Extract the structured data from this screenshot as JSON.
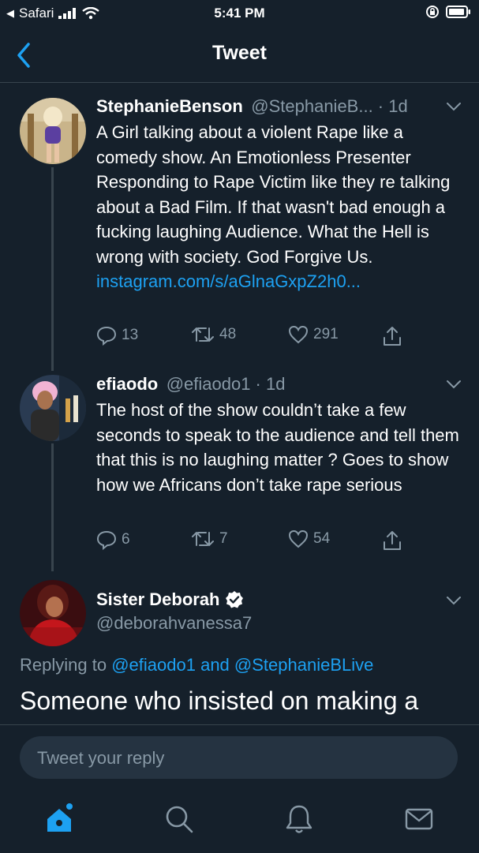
{
  "status_bar": {
    "back_app": "Safari",
    "time": "5:41 PM"
  },
  "header": {
    "title": "Tweet"
  },
  "tweets": [
    {
      "display_name": "StephanieBenson",
      "handle_time": "@StephanieB... · 1d",
      "text": "A Girl talking about a violent Rape like a comedy show. An Emotionless Presenter Responding to Rape Victim like they re talking about a Bad Film. If that wasn't bad enough a fucking laughing Audience. What the Hell is wrong with society. God Forgive Us.",
      "link": "instagram.com/s/aGlnaGxpZ2h0...",
      "replies": "13",
      "retweets": "48",
      "likes": "291"
    },
    {
      "display_name": "efiaodo",
      "handle_time": "@efiaodo1 · 1d",
      "text": "The host of the show couldn’t take a few seconds to speak to the audience and tell them that this is no laughing matter ? Goes to show how we Africans don’t take rape serious",
      "replies": "6",
      "retweets": "7",
      "likes": "54"
    },
    {
      "display_name": "Sister Deborah",
      "handle": "@deborahvanessa7"
    }
  ],
  "replying": {
    "prefix": "Replying to",
    "mention1": "@efiaodo1",
    "and": "and",
    "mention2": "@StephanieBLive"
  },
  "main_text": "Someone who insisted on making a",
  "composer": {
    "placeholder": "Tweet your reply"
  },
  "colors": {
    "background": "#15202b",
    "accent": "#1da1f2",
    "muted": "#8899a6"
  }
}
